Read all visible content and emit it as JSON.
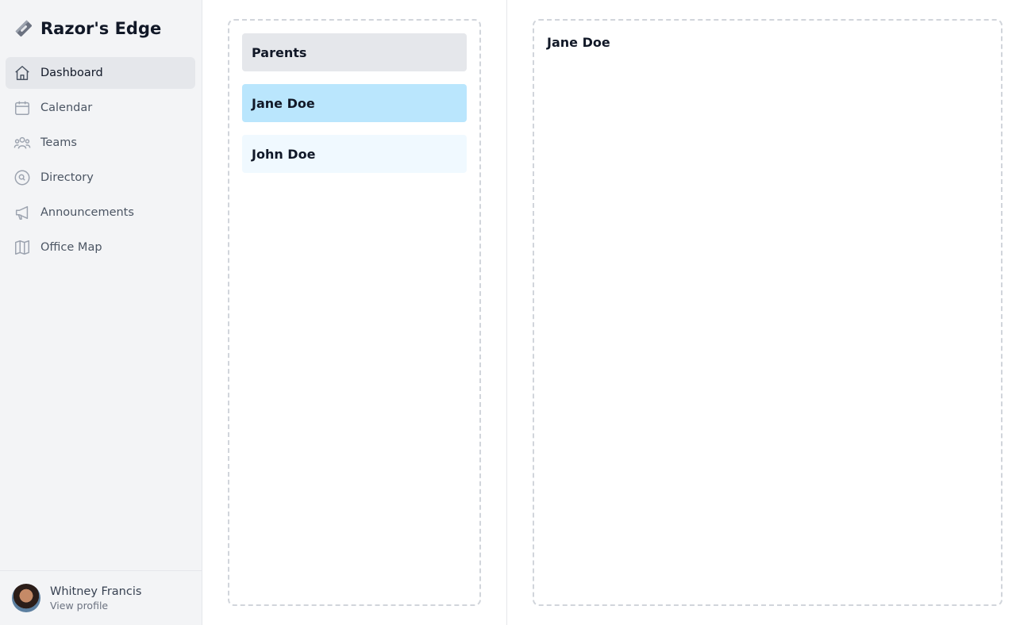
{
  "app": {
    "title": "Razor's Edge"
  },
  "sidebar": {
    "items": [
      {
        "label": "Dashboard",
        "icon": "home-icon",
        "active": true
      },
      {
        "label": "Calendar",
        "icon": "calendar-icon"
      },
      {
        "label": "Teams",
        "icon": "users-icon"
      },
      {
        "label": "Directory",
        "icon": "search-circle-icon"
      },
      {
        "label": "Announcements",
        "icon": "speakerphone-icon"
      },
      {
        "label": "Office Map",
        "icon": "map-icon"
      }
    ],
    "profile": {
      "name": "Whitney Francis",
      "action": "View profile"
    }
  },
  "list": {
    "header": "Parents",
    "items": [
      {
        "name": "Jane Doe",
        "selected": true
      },
      {
        "name": "John Doe",
        "selected": false
      }
    ]
  },
  "detail": {
    "title": "Jane Doe"
  },
  "colors": {
    "sidebar_bg": "#f3f4f6",
    "active_nav": "#e5e7eb",
    "selected_card": "#bae6fd",
    "card": "#f0f9ff"
  }
}
